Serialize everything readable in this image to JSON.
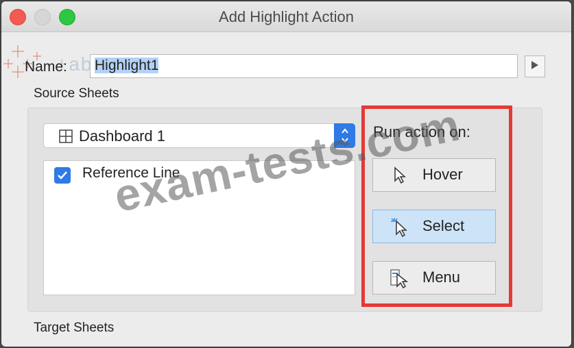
{
  "window": {
    "title": "Add Highlight Action"
  },
  "logo": {
    "text": "+ableau"
  },
  "name_field": {
    "label": "Name:",
    "value": "Highlight1"
  },
  "source_sheets": {
    "label": "Source Sheets",
    "dropdown_value": "Dashboard 1",
    "items": [
      {
        "label": "Reference Line",
        "checked": true
      }
    ]
  },
  "run_action": {
    "label": "Run action on:",
    "options": [
      {
        "label": "Hover",
        "selected": false,
        "icon": "hover-cursor-icon"
      },
      {
        "label": "Select",
        "selected": true,
        "icon": "select-cursor-icon"
      },
      {
        "label": "Menu",
        "selected": false,
        "icon": "menu-cursor-icon"
      }
    ]
  },
  "target_sheets": {
    "label": "Target Sheets"
  },
  "watermark": {
    "text": "exam-tests.com"
  },
  "colors": {
    "accent": "#2f7ae5",
    "highlight_border": "#e53935",
    "selected_bg": "#cde4f8"
  }
}
